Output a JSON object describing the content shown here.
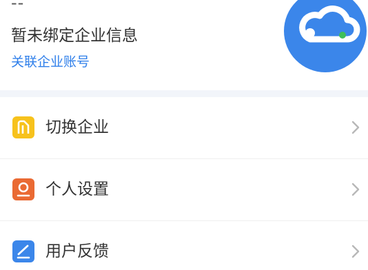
{
  "profile": {
    "name_placeholder": "--",
    "company_status": "暂未绑定企业信息",
    "link_account_label": "关联企业账号",
    "avatar_icon": "cloud-icon"
  },
  "menu": {
    "items": [
      {
        "label": "切换企业",
        "icon": "building-icon",
        "color": "#f7c21c"
      },
      {
        "label": "个人设置",
        "icon": "person-icon",
        "color": "#ea6a33"
      },
      {
        "label": "用户反馈",
        "icon": "edit-icon",
        "color": "#3b86ea"
      }
    ]
  },
  "colors": {
    "accent": "#3b86ea",
    "link": "#2f7fea",
    "separator": "#f2f5fa"
  }
}
